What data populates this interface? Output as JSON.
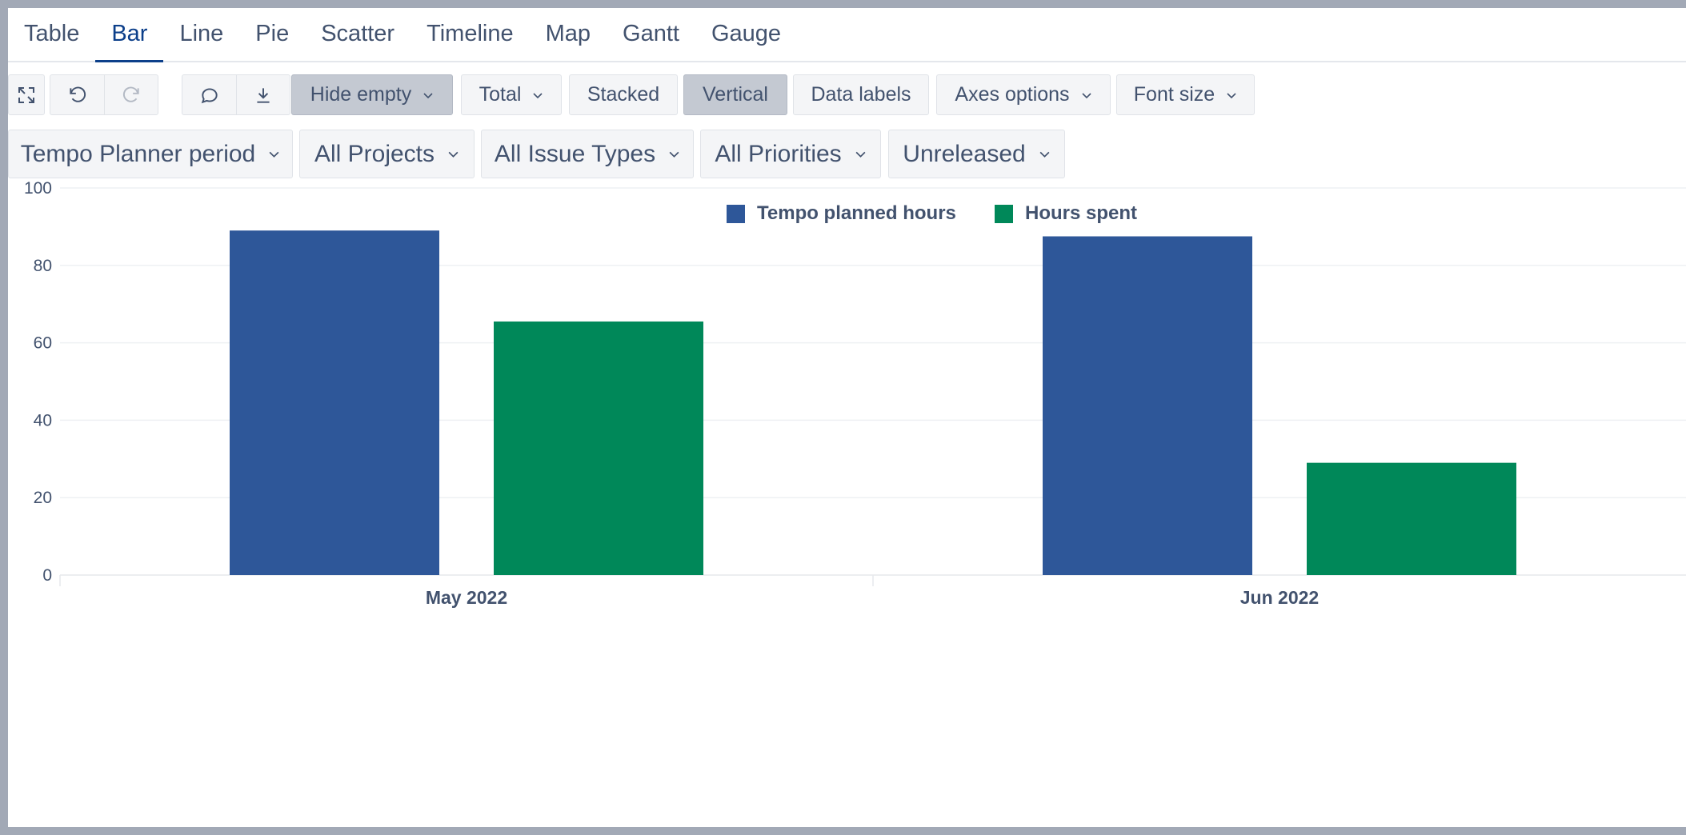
{
  "tabs": [
    "Table",
    "Bar",
    "Line",
    "Pie",
    "Scatter",
    "Timeline",
    "Map",
    "Gantt",
    "Gauge"
  ],
  "active_tab": "Bar",
  "toolbar": {
    "hide_empty": "Hide empty",
    "total": "Total",
    "stacked": "Stacked",
    "vertical": "Vertical",
    "data_labels": "Data labels",
    "axes_options": "Axes options",
    "font_size": "Font size"
  },
  "filters": {
    "period": "Tempo Planner period",
    "projects": "All Projects",
    "issue_types": "All Issue Types",
    "priorities": "All Priorities",
    "releases": "Unreleased"
  },
  "colors": {
    "planned": "#2e5799",
    "spent": "#008859",
    "accent": "#0c3f8a"
  },
  "chart_data": {
    "type": "bar",
    "categories": [
      "May 2022",
      "Jun 2022"
    ],
    "series": [
      {
        "name": "Tempo planned hours",
        "values": [
          89,
          87.5
        ]
      },
      {
        "name": "Hours spent",
        "values": [
          65.5,
          29
        ]
      }
    ],
    "ylim": [
      0,
      100
    ],
    "yticks": [
      0,
      20,
      40,
      60,
      80,
      100
    ],
    "grid": true,
    "legend_position": "top"
  }
}
